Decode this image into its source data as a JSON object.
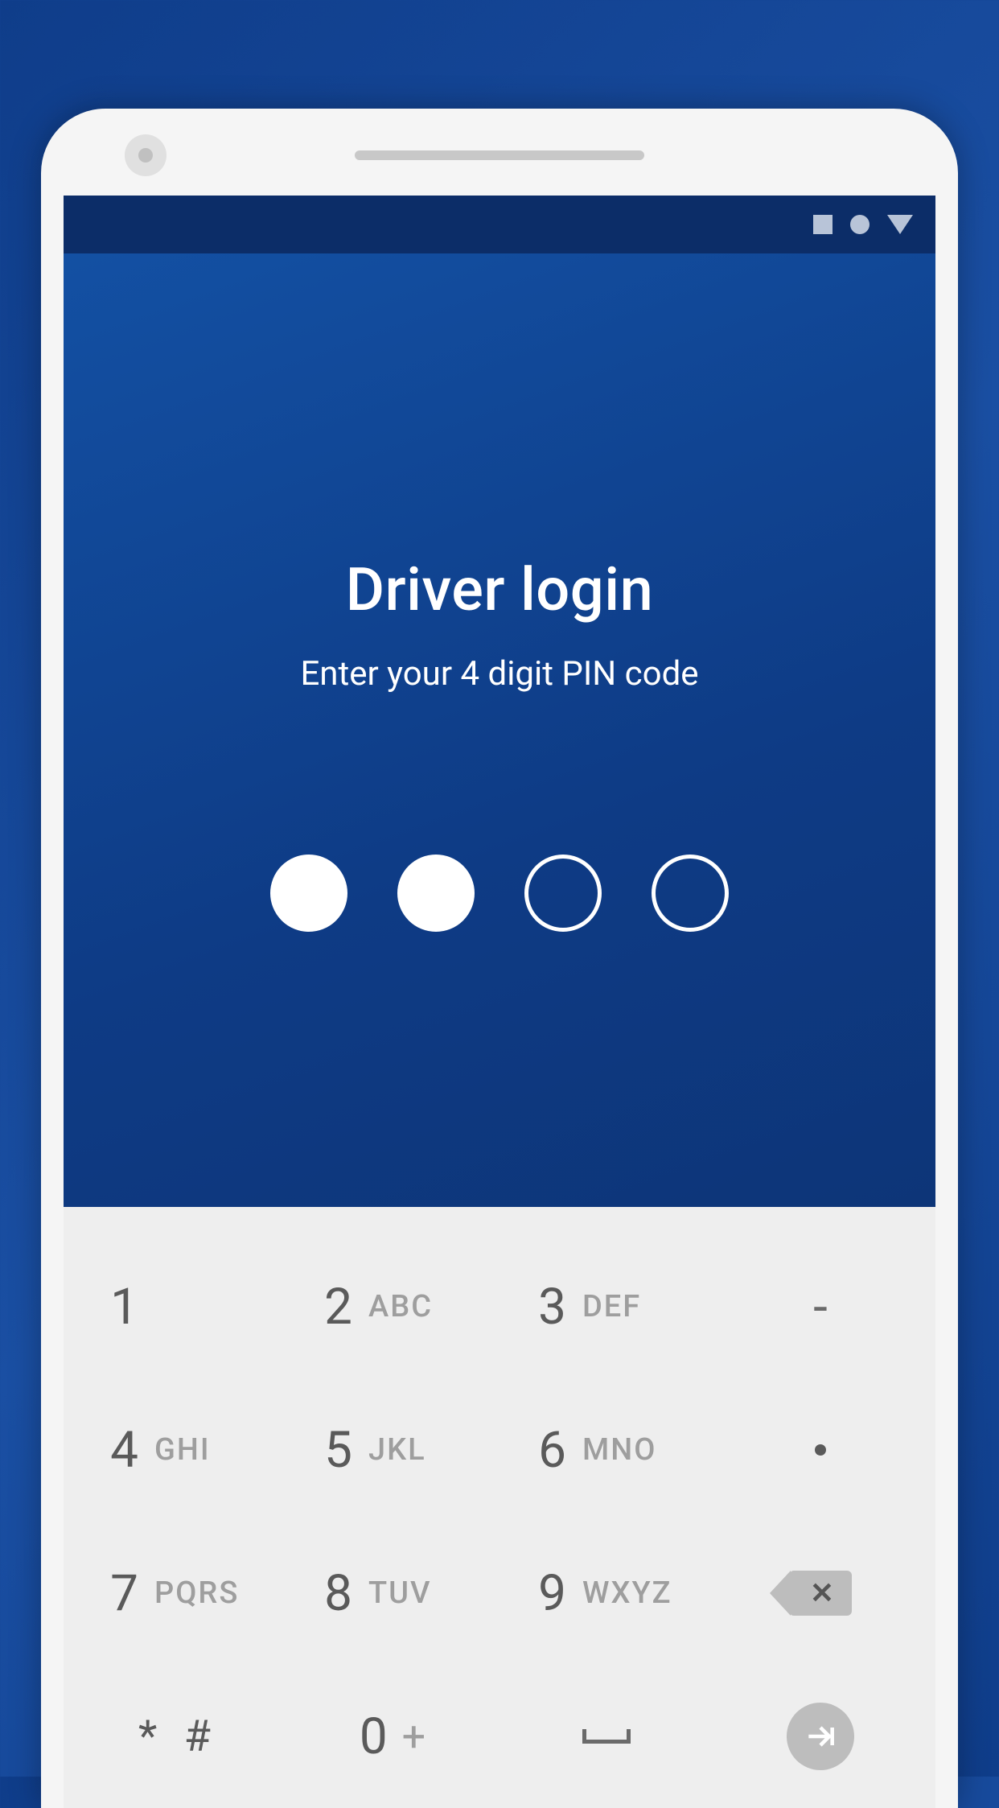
{
  "login": {
    "title": "Driver login",
    "subtitle": "Enter your 4 digit PIN code",
    "pin_length": 4,
    "pin_entered": 2
  },
  "keypad": {
    "keys": [
      [
        {
          "digit": "1",
          "letters": ""
        },
        {
          "digit": "2",
          "letters": "ABC"
        },
        {
          "digit": "3",
          "letters": "DEF"
        },
        {
          "special": "dash",
          "display": "-"
        }
      ],
      [
        {
          "digit": "4",
          "letters": "GHI"
        },
        {
          "digit": "5",
          "letters": "JKL"
        },
        {
          "digit": "6",
          "letters": "MNO"
        },
        {
          "special": "dot"
        }
      ],
      [
        {
          "digit": "7",
          "letters": "PQRS"
        },
        {
          "digit": "8",
          "letters": "TUV"
        },
        {
          "digit": "9",
          "letters": "WXYZ"
        },
        {
          "special": "backspace"
        }
      ],
      [
        {
          "special": "symbols",
          "display": "* #"
        },
        {
          "digit": "0",
          "plus": "+"
        },
        {
          "special": "space"
        },
        {
          "special": "submit"
        }
      ]
    ]
  }
}
